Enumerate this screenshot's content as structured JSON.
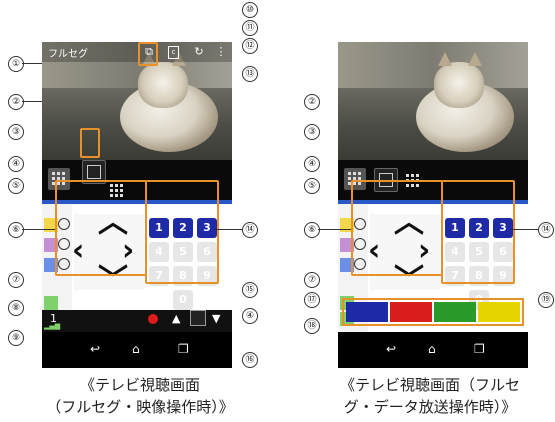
{
  "screens": {
    "left": {
      "title": "フルセグ",
      "channel": "1",
      "caption_line1": "《テレビ視聴画面",
      "caption_line2": "（フルセグ・映像操作時）》"
    },
    "right": {
      "caption_line1": "《テレビ視聴画面（フルセ",
      "caption_line2": "グ・データ放送操作時）》"
    }
  },
  "numpad_labels": [
    "1",
    "2",
    "3",
    "4",
    "5",
    "6",
    "7",
    "8",
    "9",
    "0"
  ],
  "callouts": [
    "①",
    "②",
    "③",
    "④",
    "⑤",
    "⑥",
    "⑦",
    "⑧",
    "⑨",
    "⑩",
    "⑪",
    "⑫",
    "⑬",
    "⑭",
    "⑮",
    "⑯",
    "⑰",
    "⑱",
    "⑲"
  ],
  "colors": {
    "accent": "#e8902a",
    "blue": "#1f2aa6",
    "red": "#d81e1e",
    "green": "#2a9b2a",
    "yellow": "#e6d400"
  }
}
